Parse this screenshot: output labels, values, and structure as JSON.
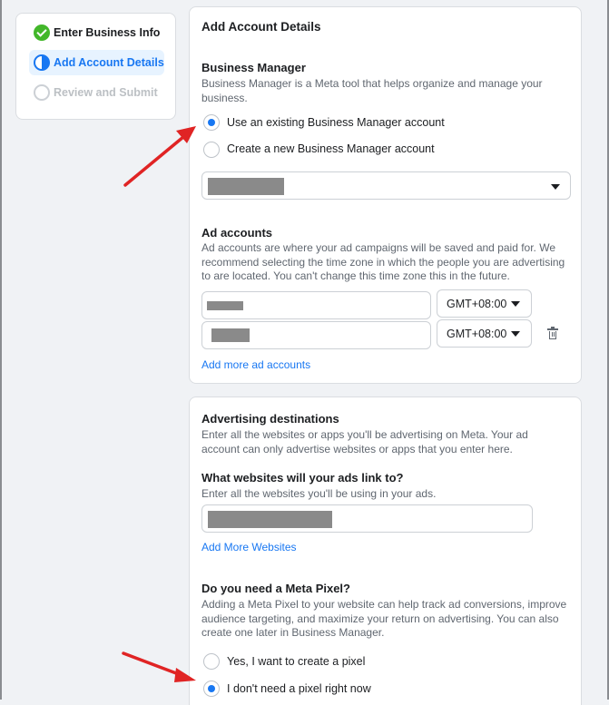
{
  "steps": [
    {
      "label": "Enter Business Info",
      "state": "done"
    },
    {
      "label": "Add Account Details",
      "state": "current"
    },
    {
      "label": "Review and Submit",
      "state": "pending"
    }
  ],
  "account_card": {
    "title": "Add Account Details",
    "business_manager": {
      "heading": "Business Manager",
      "description_line1": "Business Manager is a Meta tool that helps organize and manage your",
      "description_line2": "business.",
      "options": [
        {
          "label": "Use an existing Business Manager account",
          "selected": true
        },
        {
          "label": "Create a new Business Manager account",
          "selected": false
        }
      ]
    },
    "ad_accounts": {
      "heading": "Ad accounts",
      "description_line1": "Ad accounts are where your ad campaigns will be saved and paid for. We",
      "description_line2": "recommend selecting the time zone in which the people you are advertising",
      "description_line3": "to are located. You can't change this time zone this in the future.",
      "rows": [
        {
          "timezone": "GMT+08:00"
        },
        {
          "timezone": "GMT+08:00"
        }
      ],
      "add_more_label": "Add more ad accounts"
    }
  },
  "destinations_card": {
    "heading": "Advertising destinations",
    "description_line1": "Enter all the websites or apps you'll be advertising on Meta. Your ad",
    "description_line2": "account can only advertise websites or apps that you enter here.",
    "websites": {
      "heading": "What websites will your ads link to?",
      "description": "Enter all the websites you'll be using in your ads.",
      "add_more_label": "Add More Websites"
    },
    "pixel": {
      "heading": "Do you need a Meta Pixel?",
      "description_line1": "Adding a Meta Pixel to your website can help track ad conversions, improve",
      "description_line2": "audience targeting, and maximize your return on advertising. You can also",
      "description_line3": "create one later in Business Manager.",
      "options": [
        {
          "label": "Yes, I want to create a pixel",
          "selected": false
        },
        {
          "label": "I don't need a pixel right now",
          "selected": true
        }
      ]
    }
  },
  "colors": {
    "accent": "#1877f2",
    "success": "#42b72a",
    "annotation": "#e02424"
  }
}
